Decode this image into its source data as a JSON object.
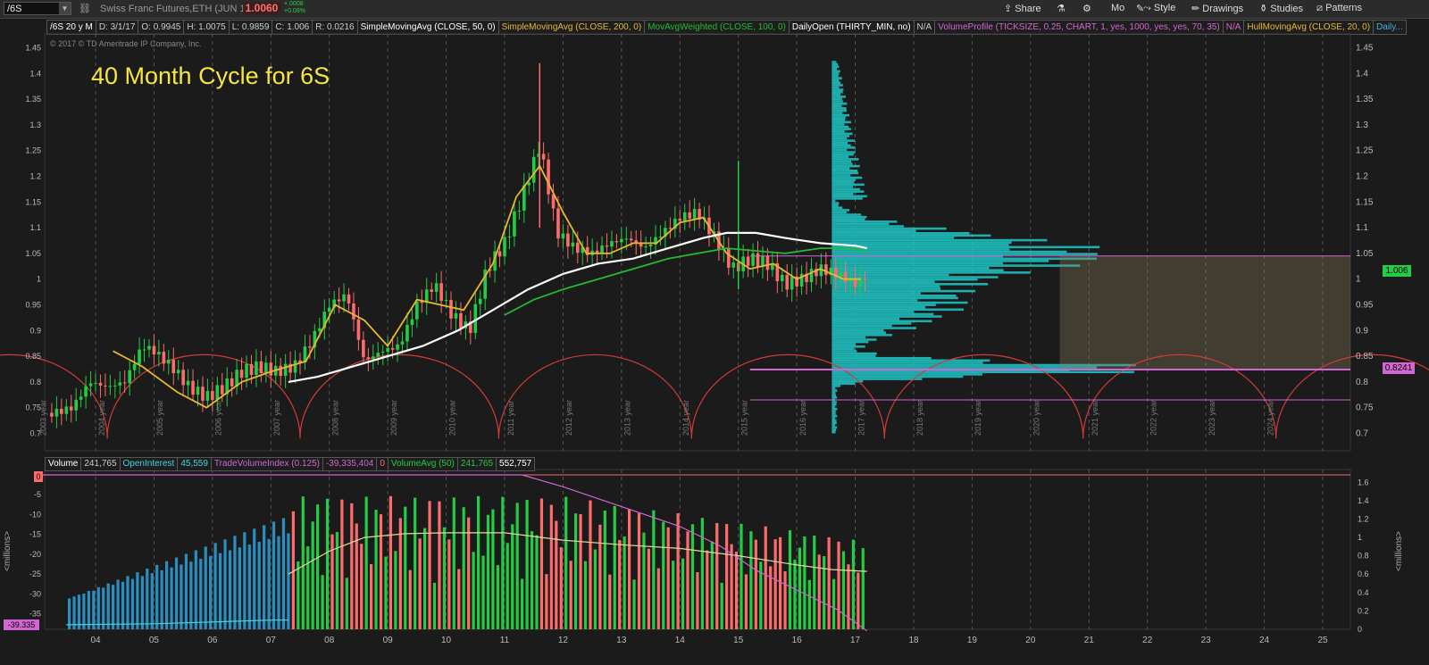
{
  "toolbar": {
    "symbol": "/6S",
    "description": "Swiss Franc Futures,ETH (JUN 17)",
    "last_price": "1.0060",
    "change_abs": "+.0008",
    "change_pct": "+0.08%",
    "share": "Share",
    "mo": "Mo",
    "style": "Style",
    "drawings": "Drawings",
    "studies": "Studies",
    "patterns": "Patterns"
  },
  "study_bar": {
    "period": "/6S 20 y M",
    "date": "D: 3/1/17",
    "open": "O: 0.9945",
    "high": "H: 1.0075",
    "low": "L: 0.9859",
    "close": "C: 1.006",
    "range": "R: 0.0216",
    "sma50": "SimpleMovingAvg (CLOSE, 50, 0)",
    "sma200": "SimpleMovingAvg (CLOSE, 200, 0)",
    "mavw": "MovAvgWeighted (CLOSE, 100, 0)",
    "dailyopen": "DailyOpen (THIRTY_MIN, no)",
    "na1": "N/A",
    "volprofile": "VolumeProfile (TICKSIZE, 0.25, CHART, 1, yes, 1000, yes, yes, 70, 35)",
    "na2": "N/A",
    "hull": "HullMovingAvg (CLOSE, 20, 0)",
    "daily": "Daily..."
  },
  "copyright": "© 2017 © TD Ameritrade IP Company, Inc.",
  "annotation_title": "40 Month Cycle for 6S",
  "volume_bar": {
    "volume_label": "Volume",
    "volume_value": "241,765",
    "oi_label": "OpenInterest",
    "oi_value": "45,559",
    "tvi_label": "TradeVolumeIndex (0.125)",
    "tvi_value": "-39,335,404",
    "zero": "0",
    "volavg_label": "VolumeAvg (50)",
    "volavg_value": "241,765",
    "last_value": "552,757"
  },
  "tags": {
    "last_price_tag": "1.006",
    "level_tag": "0.8241",
    "zero_tag": "0",
    "tvi_tag": "-39.335"
  },
  "colors": {
    "background": "#1b1b1b",
    "up_bar": "#22cc44",
    "down_bar": "#ff6b6b",
    "volume_profile": "#1ec8c8",
    "sma50": "#e8b830",
    "sma200": "#ffffff",
    "mavw": "#22bb33",
    "cycle_arcs": "#d23a3a",
    "level_lines": "#d266d2",
    "title_text": "#f5e642"
  },
  "chart_data": [
    {
      "type": "candlestick",
      "title": "/6S 20 y M",
      "x_ticks": [
        "04",
        "05",
        "06",
        "07",
        "08",
        "09",
        "10",
        "11",
        "12",
        "13",
        "14",
        "15",
        "16",
        "17",
        "18",
        "19",
        "20",
        "21",
        "22",
        "23",
        "24",
        "25"
      ],
      "y_ticks": [
        "0.7",
        "0.75",
        "0.8",
        "0.85",
        "0.9",
        "0.95",
        "1",
        "1.05",
        "1.1",
        "1.15",
        "1.2",
        "1.25",
        "1.3",
        "1.35",
        "1.4",
        "1.45"
      ],
      "ylim": [
        0.68,
        1.47
      ],
      "cycle_labels": [
        "2003 year",
        "2004 year",
        "2005 year",
        "2006 year",
        "2007 year",
        "2008 year",
        "2009 year",
        "2010 year",
        "2011 year",
        "2012 year",
        "2013 year",
        "2014 year",
        "2015 year",
        "2016 year",
        "2017 year",
        "2018 year",
        "2019 year",
        "2020 year",
        "2021 year",
        "2022 year",
        "2023 year",
        "2024 year"
      ],
      "cycle_period_months": 40,
      "cycle_troughs_year": [
        2004.2,
        2007.5,
        2010.9,
        2014.2,
        2017.5,
        2020.9,
        2024.2
      ],
      "close_path": [
        [
          2003.3,
          0.74
        ],
        [
          2003.6,
          0.75
        ],
        [
          2003.9,
          0.8
        ],
        [
          2004.2,
          0.79
        ],
        [
          2004.5,
          0.8
        ],
        [
          2004.8,
          0.87
        ],
        [
          2005.0,
          0.86
        ],
        [
          2005.3,
          0.83
        ],
        [
          2005.6,
          0.79
        ],
        [
          2005.9,
          0.77
        ],
        [
          2006.2,
          0.79
        ],
        [
          2006.5,
          0.82
        ],
        [
          2006.8,
          0.83
        ],
        [
          2007.1,
          0.82
        ],
        [
          2007.4,
          0.83
        ],
        [
          2007.7,
          0.88
        ],
        [
          2008.0,
          0.95
        ],
        [
          2008.3,
          0.97
        ],
        [
          2008.6,
          0.84
        ],
        [
          2008.9,
          0.86
        ],
        [
          2009.2,
          0.87
        ],
        [
          2009.5,
          0.95
        ],
        [
          2009.8,
          0.99
        ],
        [
          2010.1,
          0.93
        ],
        [
          2010.4,
          0.9
        ],
        [
          2010.7,
          1.02
        ],
        [
          2011.0,
          1.07
        ],
        [
          2011.3,
          1.16
        ],
        [
          2011.6,
          1.26
        ],
        [
          2011.9,
          1.09
        ],
        [
          2012.2,
          1.06
        ],
        [
          2012.5,
          1.05
        ],
        [
          2012.8,
          1.07
        ],
        [
          2013.1,
          1.08
        ],
        [
          2013.4,
          1.06
        ],
        [
          2013.7,
          1.09
        ],
        [
          2014.0,
          1.12
        ],
        [
          2014.3,
          1.13
        ],
        [
          2014.6,
          1.08
        ],
        [
          2014.9,
          1.02
        ],
        [
          2015.2,
          1.04
        ],
        [
          2015.5,
          1.03
        ],
        [
          2015.8,
          0.99
        ],
        [
          2016.1,
          1.0
        ],
        [
          2016.4,
          1.02
        ],
        [
          2016.7,
          1.01
        ],
        [
          2017.0,
          0.99
        ],
        [
          2017.2,
          1.006
        ]
      ],
      "series": [
        {
          "name": "SimpleMovingAvg (CLOSE, 50, 0)",
          "points": [
            [
              2004.3,
              0.86
            ],
            [
              2004.8,
              0.83
            ],
            [
              2005.4,
              0.78
            ],
            [
              2005.9,
              0.75
            ],
            [
              2006.5,
              0.8
            ],
            [
              2007.0,
              0.82
            ],
            [
              2007.6,
              0.84
            ],
            [
              2008.1,
              0.95
            ],
            [
              2008.6,
              0.92
            ],
            [
              2009.0,
              0.87
            ],
            [
              2009.5,
              0.96
            ],
            [
              2009.9,
              0.95
            ],
            [
              2010.3,
              0.94
            ],
            [
              2010.8,
              1.03
            ],
            [
              2011.2,
              1.16
            ],
            [
              2011.6,
              1.22
            ],
            [
              2012.0,
              1.13
            ],
            [
              2012.4,
              1.05
            ],
            [
              2012.8,
              1.05
            ],
            [
              2013.2,
              1.07
            ],
            [
              2013.6,
              1.07
            ],
            [
              2014.0,
              1.11
            ],
            [
              2014.4,
              1.12
            ],
            [
              2014.8,
              1.05
            ],
            [
              2015.2,
              1.02
            ],
            [
              2015.6,
              1.03
            ],
            [
              2016.0,
              1.0
            ],
            [
              2016.4,
              1.02
            ],
            [
              2016.8,
              1.0
            ],
            [
              2017.1,
              1.0
            ]
          ]
        },
        {
          "name": "SimpleMovingAvg (CLOSE, 200, 0)",
          "points": [
            [
              2007.3,
              0.8
            ],
            [
              2007.8,
              0.81
            ],
            [
              2008.4,
              0.83
            ],
            [
              2009.0,
              0.85
            ],
            [
              2009.6,
              0.87
            ],
            [
              2010.2,
              0.9
            ],
            [
              2010.8,
              0.94
            ],
            [
              2011.4,
              0.98
            ],
            [
              2012.0,
              1.01
            ],
            [
              2012.6,
              1.03
            ],
            [
              2013.2,
              1.04
            ],
            [
              2013.8,
              1.06
            ],
            [
              2014.4,
              1.08
            ],
            [
              2014.8,
              1.09
            ],
            [
              2015.3,
              1.09
            ],
            [
              2015.8,
              1.08
            ],
            [
              2016.4,
              1.07
            ],
            [
              2017.0,
              1.065
            ],
            [
              2017.2,
              1.06
            ]
          ]
        },
        {
          "name": "MovAvgWeighted (CLOSE, 100, 0)",
          "points": [
            [
              2011.0,
              0.93
            ],
            [
              2011.5,
              0.96
            ],
            [
              2012.0,
              0.98
            ],
            [
              2012.6,
              1.0
            ],
            [
              2013.2,
              1.02
            ],
            [
              2013.8,
              1.04
            ],
            [
              2014.3,
              1.05
            ],
            [
              2014.8,
              1.06
            ],
            [
              2015.3,
              1.055
            ],
            [
              2015.8,
              1.05
            ],
            [
              2016.4,
              1.06
            ],
            [
              2016.9,
              1.06
            ],
            [
              2017.2,
              1.055
            ]
          ]
        }
      ],
      "volume_profile_levels": {
        "poc": 0.8241,
        "value_area_high": 1.045,
        "value_area_low": 0.765
      },
      "last_price": 1.006
    },
    {
      "type": "bar",
      "title": "Volume",
      "y_ticks_right": [
        "0",
        "0.2",
        "0.4",
        "0.6",
        "0.8",
        "1",
        "1.2",
        "1.4",
        "1.6"
      ],
      "ylim_right": [
        0,
        1.7
      ],
      "ylabel_right": "<millions>",
      "y_ticks_left": [
        "0",
        "-5",
        "-10",
        "-15",
        "-20",
        "-25",
        "-30",
        "-35"
      ],
      "ylim_left": [
        -38,
        0
      ],
      "ylabel_left": "<millions>",
      "series": [
        {
          "name": "Volume",
          "values": []
        },
        {
          "name": "VolumeAvg (50)",
          "points": [
            [
              2007.3,
              0.6
            ],
            [
              2008.0,
              0.85
            ],
            [
              2008.6,
              1.0
            ],
            [
              2009.3,
              1.04
            ],
            [
              2010.0,
              1.05
            ],
            [
              2011.0,
              1.05
            ],
            [
              2012.0,
              0.97
            ],
            [
              2013.0,
              0.92
            ],
            [
              2014.0,
              0.88
            ],
            [
              2015.0,
              0.8
            ],
            [
              2016.0,
              0.7
            ],
            [
              2016.6,
              0.65
            ],
            [
              2017.2,
              0.63
            ]
          ]
        },
        {
          "name": "TradeVolumeIndex (0.125)",
          "points": [
            [
              2003.0,
              0.0
            ],
            [
              2011.3,
              0.0
            ],
            [
              2012.0,
              -3
            ],
            [
              2013.0,
              -8
            ],
            [
              2014.0,
              -13
            ],
            [
              2014.7,
              -18
            ],
            [
              2015.3,
              -24
            ],
            [
              2016.0,
              -29
            ],
            [
              2016.7,
              -34
            ],
            [
              2017.2,
              -39.3
            ]
          ]
        },
        {
          "name": "OpenInterest",
          "points": [
            [
              2003.5,
              0.05
            ],
            [
              2005.0,
              0.06
            ],
            [
              2006.0,
              0.08
            ],
            [
              2007.0,
              0.1
            ],
            [
              2007.3,
              0.1
            ]
          ]
        }
      ]
    }
  ]
}
